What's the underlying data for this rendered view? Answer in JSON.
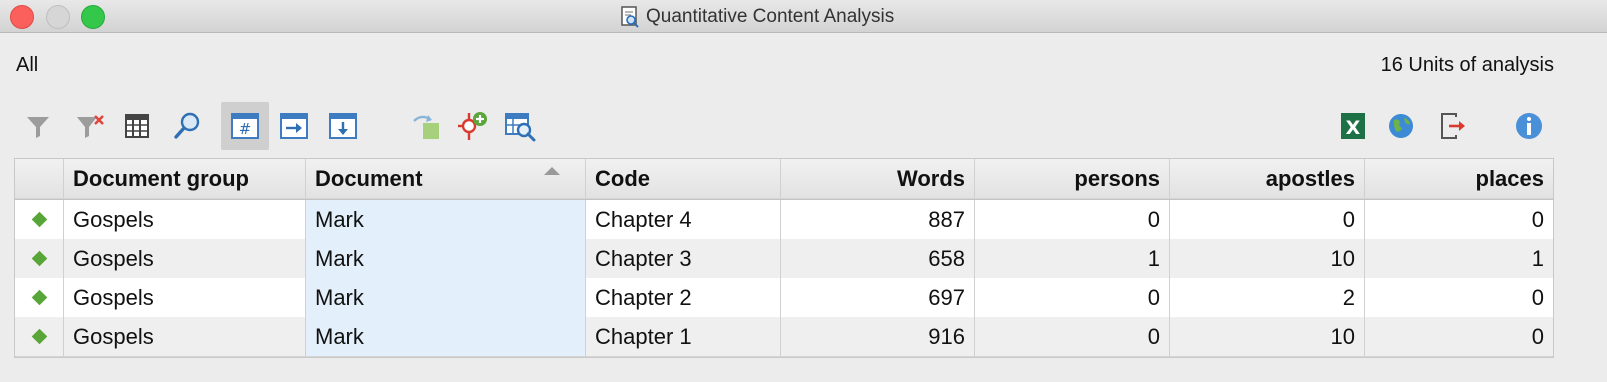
{
  "window": {
    "title": "Quantitative Content Analysis"
  },
  "header": {
    "scope": "All",
    "units": "16 Units of analysis"
  },
  "toolbar": {
    "left": [
      "filter-icon",
      "clear-filter-icon",
      "columns-icon",
      "search-icon",
      "number-display-icon",
      "next-icon",
      "download-icon"
    ],
    "middle": [
      "rotate-icon",
      "add-code-icon",
      "table-search-icon"
    ],
    "right": [
      "excel-icon",
      "globe-icon",
      "export-icon",
      "info-icon"
    ]
  },
  "table": {
    "columns": [
      "",
      "Document group",
      "Document",
      "Code",
      "Words",
      "persons",
      "apostles",
      "places"
    ],
    "rows": [
      {
        "group": "Gospels",
        "document": "Mark",
        "code": "Chapter 4",
        "words": "887",
        "persons": "0",
        "apostles": "0",
        "places": "0"
      },
      {
        "group": "Gospels",
        "document": "Mark",
        "code": "Chapter 3",
        "words": "658",
        "persons": "1",
        "apostles": "10",
        "places": "1"
      },
      {
        "group": "Gospels",
        "document": "Mark",
        "code": "Chapter 2",
        "words": "697",
        "persons": "0",
        "apostles": "2",
        "places": "0"
      },
      {
        "group": "Gospels",
        "document": "Mark",
        "code": "Chapter 1",
        "words": "916",
        "persons": "0",
        "apostles": "10",
        "places": "0"
      }
    ]
  },
  "colors": {
    "row_marker": "#59a638",
    "selected_column": "#e3f0fb"
  }
}
